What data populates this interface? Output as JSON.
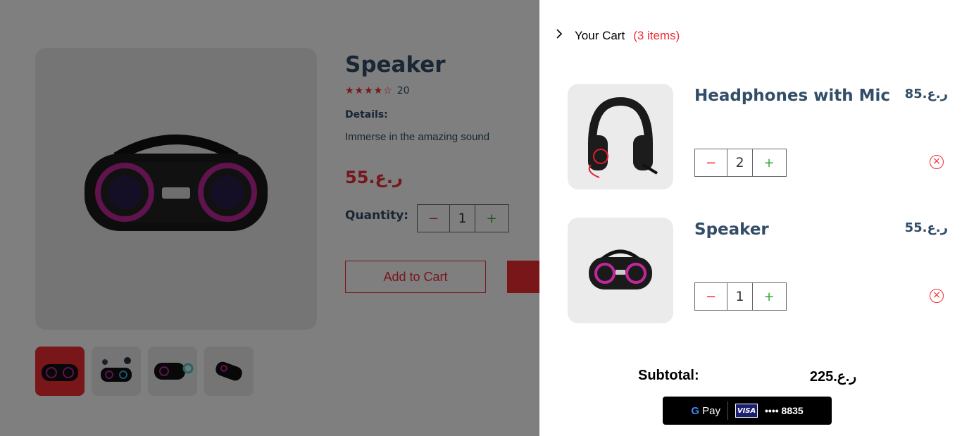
{
  "product": {
    "title": "Speaker",
    "rating_stars": "★★★★☆",
    "reviews": "20",
    "details_heading": "Details:",
    "details": "Immerse in the amazing sound",
    "price": "ر.ع.55",
    "quantity_label": "Quantity:",
    "quantity": "1",
    "add_to_cart": "Add to Cart",
    "thumbnails": [
      "speaker-thumb-1",
      "speaker-thumb-2",
      "speaker-thumb-3",
      "speaker-thumb-4"
    ]
  },
  "cart": {
    "title": "Your Cart",
    "count_label": "(3 items)",
    "items": [
      {
        "name": "Headphones with Mic",
        "price": "ر.ع.85",
        "quantity": "2"
      },
      {
        "name": "Speaker",
        "price": "ر.ع.55",
        "quantity": "1"
      }
    ],
    "subtotal_label": "Subtotal:",
    "subtotal_value": "ر.ع.225",
    "pay": {
      "label": "Pay",
      "card_brand": "VISA",
      "card_mask": "•••• 8835"
    }
  },
  "colors": {
    "accent": "#f02d34",
    "text": "#324d67",
    "plus": "#31a831"
  }
}
